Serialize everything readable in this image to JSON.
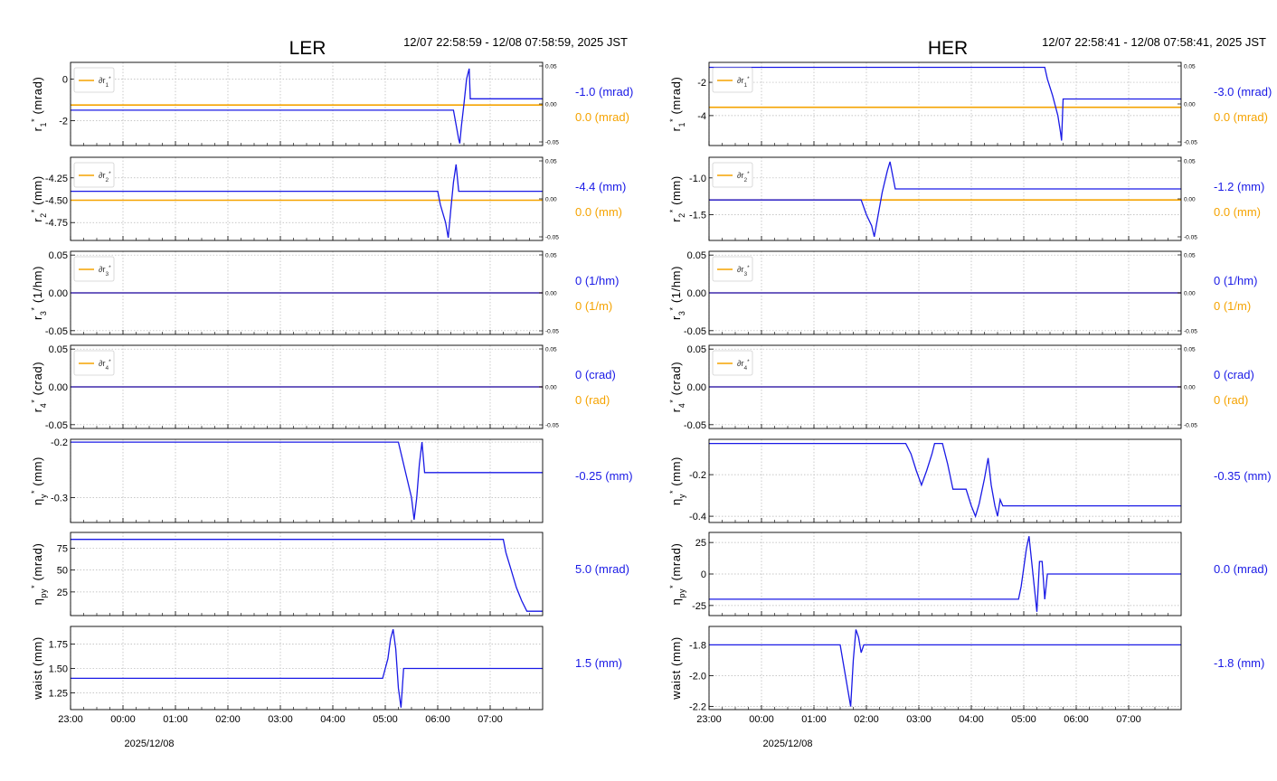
{
  "colors": {
    "blue": "#1a1ae6",
    "orange": "#f5a300",
    "grid": "#b5b5b5"
  },
  "date_label": "2025/12/08",
  "chart_data": [
    {
      "type": "line",
      "title": "LER",
      "subtitle": "12/07 22:58:59 - 12/08 07:58:59, 2025 JST",
      "x_tick_labels": [
        "23:00",
        "00:00",
        "01:00",
        "02:00",
        "03:00",
        "04:00",
        "05:00",
        "06:00",
        "07:00"
      ],
      "x_range": [
        23.0,
        32.0
      ],
      "panels": [
        {
          "ylabel": "r1*(mrad)",
          "ylabel_sub": "1",
          "ylim": [
            -3.2,
            0.8
          ],
          "yticks": [
            "0",
            "-2"
          ],
          "ytick_values": [
            0,
            -2
          ],
          "right_axis": true,
          "rlim": [
            -0.05,
            0.05
          ],
          "right_ticks": [
            "0.05",
            "0.00",
            "-0.05"
          ],
          "legend": "∂r1*",
          "legend_sub": "1",
          "value_main": "-1.0 (mrad)",
          "value_secondary": "0.0 (mrad)",
          "blue": [
            [
              23.0,
              -1.5
            ],
            [
              30.3,
              -1.5
            ],
            [
              30.35,
              -2.2
            ],
            [
              30.4,
              -2.9
            ],
            [
              30.42,
              -3.1
            ],
            [
              30.45,
              -2.3
            ],
            [
              30.5,
              -1.2
            ],
            [
              30.55,
              0.0
            ],
            [
              30.6,
              0.5
            ],
            [
              30.62,
              -0.95
            ],
            [
              32.0,
              -0.95
            ]
          ],
          "orange": [
            [
              23.0,
              -1.25
            ],
            [
              32.0,
              -1.25
            ]
          ]
        },
        {
          "ylabel": "r2*(mm)",
          "ylabel_sub": "2",
          "ylim": [
            -4.95,
            -4.02
          ],
          "yticks": [
            "-4.25",
            "-4.50",
            "-4.75"
          ],
          "ytick_values": [
            -4.25,
            -4.5,
            -4.75
          ],
          "right_axis": true,
          "rlim": [
            -0.05,
            0.05
          ],
          "right_ticks": [
            "0.05",
            "0.00",
            "-0.05"
          ],
          "legend": "∂r2*",
          "legend_sub": "2",
          "value_main": "-4.4 (mm)",
          "value_secondary": "0.0 (mm)",
          "blue": [
            [
              23.0,
              -4.4
            ],
            [
              30.0,
              -4.4
            ],
            [
              30.05,
              -4.55
            ],
            [
              30.15,
              -4.75
            ],
            [
              30.2,
              -4.92
            ],
            [
              30.25,
              -4.6
            ],
            [
              30.3,
              -4.3
            ],
            [
              30.35,
              -4.1
            ],
            [
              30.4,
              -4.4
            ],
            [
              32.0,
              -4.4
            ]
          ],
          "orange": [
            [
              23.0,
              -4.5
            ],
            [
              32.0,
              -4.5
            ]
          ]
        },
        {
          "ylabel": "r3*(1/hm)",
          "ylabel_sub": "3",
          "ylim": [
            -0.055,
            0.055
          ],
          "yticks": [
            "0.05",
            "0.00",
            "-0.05"
          ],
          "ytick_values": [
            0.05,
            0,
            -0.05
          ],
          "right_axis": true,
          "rlim": [
            -0.05,
            0.05
          ],
          "right_ticks": [
            "0.05",
            "0.00",
            "-0.05"
          ],
          "legend": "∂r3*",
          "legend_sub": "3",
          "value_main": "0 (1/hm)",
          "value_secondary": "0 (1/m)",
          "blue": [
            [
              23.0,
              0
            ],
            [
              32.0,
              0
            ]
          ],
          "orange": [
            [
              23.0,
              0
            ],
            [
              32.0,
              0
            ]
          ]
        },
        {
          "ylabel": "r4*(crad)",
          "ylabel_sub": "4",
          "ylim": [
            -0.055,
            0.055
          ],
          "yticks": [
            "0.05",
            "0.00",
            "-0.05"
          ],
          "ytick_values": [
            0.05,
            0,
            -0.05
          ],
          "right_axis": true,
          "rlim": [
            -0.05,
            0.05
          ],
          "right_ticks": [
            "0.05",
            "0.00",
            "-0.05"
          ],
          "legend": "∂r4*",
          "legend_sub": "4",
          "value_main": "0 (crad)",
          "value_secondary": "0 (rad)",
          "blue": [
            [
              23.0,
              0
            ],
            [
              32.0,
              0
            ]
          ],
          "orange": [
            [
              23.0,
              0
            ],
            [
              32.0,
              0
            ]
          ]
        },
        {
          "ylabel": "ηy*(mm)",
          "ylabel_sub": "y",
          "ylim": [
            -0.345,
            -0.195
          ],
          "yticks": [
            "-0.2",
            "-0.3"
          ],
          "ytick_values": [
            -0.2,
            -0.3
          ],
          "right_axis": false,
          "value_main": "-0.25 (mm)",
          "blue": [
            [
              23.0,
              -0.2
            ],
            [
              29.25,
              -0.2
            ],
            [
              29.3,
              -0.22
            ],
            [
              29.4,
              -0.26
            ],
            [
              29.5,
              -0.3
            ],
            [
              29.55,
              -0.34
            ],
            [
              29.6,
              -0.3
            ],
            [
              29.65,
              -0.24
            ],
            [
              29.7,
              -0.2
            ],
            [
              29.75,
              -0.255
            ],
            [
              32.0,
              -0.255
            ]
          ]
        },
        {
          "ylabel": "ηpy*(mrad)",
          "ylabel_sub": "py",
          "ylim": [
            -2,
            93
          ],
          "yticks": [
            "75",
            "50",
            "25"
          ],
          "ytick_values": [
            75,
            50,
            25
          ],
          "right_axis": false,
          "value_main": "5.0 (mrad)",
          "blue": [
            [
              23.0,
              85
            ],
            [
              31.25,
              85
            ],
            [
              31.3,
              70
            ],
            [
              31.4,
              50
            ],
            [
              31.5,
              30
            ],
            [
              31.6,
              15
            ],
            [
              31.7,
              3
            ],
            [
              32.0,
              3
            ]
          ]
        },
        {
          "ylabel": "waist (mm)",
          "ylabel_sub": "",
          "ylim": [
            1.08,
            1.93
          ],
          "yticks": [
            "1.75",
            "1.50",
            "1.25"
          ],
          "ytick_values": [
            1.75,
            1.5,
            1.25
          ],
          "right_axis": false,
          "value_main": "1.5 (mm)",
          "blue": [
            [
              23.0,
              1.4
            ],
            [
              28.95,
              1.4
            ],
            [
              29.05,
              1.6
            ],
            [
              29.1,
              1.8
            ],
            [
              29.15,
              1.9
            ],
            [
              29.2,
              1.7
            ],
            [
              29.25,
              1.3
            ],
            [
              29.3,
              1.1
            ],
            [
              29.35,
              1.5
            ],
            [
              32.0,
              1.5
            ]
          ]
        }
      ]
    },
    {
      "type": "line",
      "title": "HER",
      "subtitle": "12/07 22:58:41 - 12/08 07:58:41, 2025 JST",
      "x_tick_labels": [
        "23:00",
        "00:00",
        "01:00",
        "02:00",
        "03:00",
        "04:00",
        "05:00",
        "06:00",
        "07:00"
      ],
      "x_range": [
        23.0,
        32.0
      ],
      "panels": [
        {
          "ylabel": "r1*(mrad)",
          "ylabel_sub": "1",
          "ylim": [
            -5.8,
            -0.8
          ],
          "yticks": [
            "-2",
            "-4"
          ],
          "ytick_values": [
            -2,
            -4
          ],
          "right_axis": true,
          "rlim": [
            -0.05,
            0.05
          ],
          "right_ticks": [
            "0.05",
            "0.00",
            "-0.05"
          ],
          "legend": "∂r1*",
          "legend_sub": "1",
          "value_main": "-3.0 (mrad)",
          "value_secondary": "0.0 (mrad)",
          "blue": [
            [
              23.0,
              -1.1
            ],
            [
              29.4,
              -1.1
            ],
            [
              29.45,
              -1.8
            ],
            [
              29.55,
              -2.8
            ],
            [
              29.65,
              -4.0
            ],
            [
              29.7,
              -5.0
            ],
            [
              29.72,
              -5.5
            ],
            [
              29.75,
              -3.0
            ],
            [
              32.0,
              -3.0
            ]
          ],
          "orange": [
            [
              23.0,
              -3.5
            ],
            [
              32.0,
              -3.5
            ]
          ]
        },
        {
          "ylabel": "r2*(mm)",
          "ylabel_sub": "2",
          "ylim": [
            -1.85,
            -0.72
          ],
          "yticks": [
            "-1.0",
            "-1.5"
          ],
          "ytick_values": [
            -1.0,
            -1.5
          ],
          "right_axis": true,
          "rlim": [
            -0.05,
            0.05
          ],
          "right_ticks": [
            "0.05",
            "0.00",
            "-0.05"
          ],
          "legend": "∂r2*",
          "legend_sub": "2",
          "value_main": "-1.2 (mm)",
          "value_secondary": "0.0 (mm)",
          "blue": [
            [
              23.0,
              -1.3
            ],
            [
              25.9,
              -1.3
            ],
            [
              26.0,
              -1.5
            ],
            [
              26.1,
              -1.65
            ],
            [
              26.15,
              -1.8
            ],
            [
              26.2,
              -1.6
            ],
            [
              26.3,
              -1.2
            ],
            [
              26.4,
              -0.9
            ],
            [
              26.45,
              -0.78
            ],
            [
              26.55,
              -1.15
            ],
            [
              32.0,
              -1.15
            ]
          ],
          "orange": [
            [
              23.0,
              -1.3
            ],
            [
              32.0,
              -1.3
            ]
          ]
        },
        {
          "ylabel": "r3*(1/hm)",
          "ylabel_sub": "3",
          "ylim": [
            -0.055,
            0.055
          ],
          "yticks": [
            "0.05",
            "0.00",
            "-0.05"
          ],
          "ytick_values": [
            0.05,
            0,
            -0.05
          ],
          "right_axis": true,
          "rlim": [
            -0.05,
            0.05
          ],
          "right_ticks": [
            "0.05",
            "0.00",
            "-0.05"
          ],
          "legend": "∂r3*",
          "legend_sub": "3",
          "value_main": "0 (1/hm)",
          "value_secondary": "0 (1/m)",
          "blue": [
            [
              23.0,
              0
            ],
            [
              32.0,
              0
            ]
          ],
          "orange": [
            [
              23.0,
              0
            ],
            [
              32.0,
              0
            ]
          ]
        },
        {
          "ylabel": "r4*(crad)",
          "ylabel_sub": "4",
          "ylim": [
            -0.055,
            0.055
          ],
          "yticks": [
            "0.05",
            "0.00",
            "-0.05"
          ],
          "ytick_values": [
            0.05,
            0,
            -0.05
          ],
          "right_axis": true,
          "rlim": [
            -0.05,
            0.05
          ],
          "right_ticks": [
            "0.05",
            "0.00",
            "-0.05"
          ],
          "legend": "∂r4*",
          "legend_sub": "4",
          "value_main": "0 (crad)",
          "value_secondary": "0 (rad)",
          "blue": [
            [
              23.0,
              0
            ],
            [
              32.0,
              0
            ]
          ],
          "orange": [
            [
              23.0,
              0
            ],
            [
              32.0,
              0
            ]
          ]
        },
        {
          "ylabel": "ηy*(mm)",
          "ylabel_sub": "y",
          "ylim": [
            -0.43,
            -0.03
          ],
          "yticks": [
            "-0.2",
            "-0.4"
          ],
          "ytick_values": [
            -0.2,
            -0.4
          ],
          "right_axis": false,
          "value_main": "-0.35 (mm)",
          "blue": [
            [
              23.0,
              -0.05
            ],
            [
              26.75,
              -0.05
            ],
            [
              26.85,
              -0.1
            ],
            [
              26.95,
              -0.18
            ],
            [
              27.05,
              -0.25
            ],
            [
              27.15,
              -0.18
            ],
            [
              27.25,
              -0.1
            ],
            [
              27.3,
              -0.05
            ],
            [
              27.45,
              -0.05
            ],
            [
              27.55,
              -0.15
            ],
            [
              27.65,
              -0.27
            ],
            [
              27.9,
              -0.27
            ],
            [
              28.0,
              -0.35
            ],
            [
              28.08,
              -0.4
            ],
            [
              28.15,
              -0.34
            ],
            [
              28.25,
              -0.22
            ],
            [
              28.32,
              -0.12
            ],
            [
              28.38,
              -0.25
            ],
            [
              28.45,
              -0.35
            ],
            [
              28.5,
              -0.4
            ],
            [
              28.55,
              -0.32
            ],
            [
              28.6,
              -0.35
            ],
            [
              32.0,
              -0.35
            ]
          ]
        },
        {
          "ylabel": "ηpy*(mrad)",
          "ylabel_sub": "py",
          "ylim": [
            -33,
            33
          ],
          "yticks": [
            "25",
            "0",
            "-25"
          ],
          "ytick_values": [
            25,
            0,
            -25
          ],
          "right_axis": false,
          "value_main": "0.0 (mrad)",
          "blue": [
            [
              23.0,
              -20
            ],
            [
              28.9,
              -20
            ],
            [
              28.95,
              -10
            ],
            [
              29.0,
              5
            ],
            [
              29.05,
              20
            ],
            [
              29.1,
              30
            ],
            [
              29.15,
              10
            ],
            [
              29.2,
              -10
            ],
            [
              29.25,
              -30
            ],
            [
              29.3,
              10
            ],
            [
              29.35,
              10
            ],
            [
              29.4,
              -20
            ],
            [
              29.45,
              0
            ],
            [
              32.0,
              0
            ]
          ]
        },
        {
          "ylabel": "waist (mm)",
          "ylabel_sub": "",
          "ylim": [
            -2.22,
            -1.68
          ],
          "yticks": [
            "-1.8",
            "-2.0",
            "-2.2"
          ],
          "ytick_values": [
            -1.8,
            -2.0,
            -2.2
          ],
          "right_axis": false,
          "value_main": "-1.8 (mm)",
          "blue": [
            [
              23.0,
              -1.8
            ],
            [
              25.5,
              -1.8
            ],
            [
              25.55,
              -1.9
            ],
            [
              25.6,
              -2.0
            ],
            [
              25.65,
              -2.1
            ],
            [
              25.7,
              -2.2
            ],
            [
              25.75,
              -1.9
            ],
            [
              25.8,
              -1.7
            ],
            [
              25.85,
              -1.75
            ],
            [
              25.9,
              -1.85
            ],
            [
              25.95,
              -1.8
            ],
            [
              32.0,
              -1.8
            ]
          ]
        }
      ]
    }
  ]
}
